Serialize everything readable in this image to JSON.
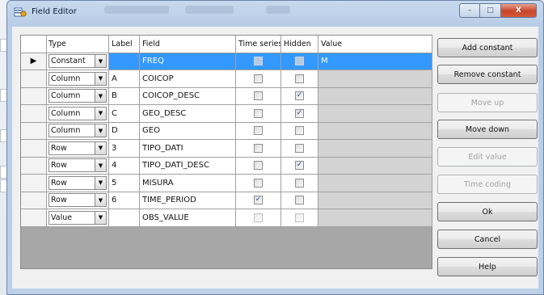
{
  "window": {
    "title": "Field Editor",
    "min_glyph": "–",
    "max_glyph": "□",
    "close_glyph": "X"
  },
  "grid": {
    "headers": [
      "Type",
      "Label",
      "Field",
      "Time series",
      "Hidden",
      "Value"
    ],
    "rows": [
      {
        "type": "Constant",
        "label": "",
        "field": "FREQ",
        "time_series": false,
        "hidden": false,
        "value": "M",
        "selected": true,
        "indicator": "▶"
      },
      {
        "type": "Column",
        "label": "A",
        "field": "COICOP",
        "time_series": false,
        "hidden": false,
        "value": ""
      },
      {
        "type": "Column",
        "label": "B",
        "field": "COICOP_DESC",
        "time_series": false,
        "hidden": true,
        "value": ""
      },
      {
        "type": "Column",
        "label": "C",
        "field": "GEO_DESC",
        "time_series": false,
        "hidden": true,
        "value": ""
      },
      {
        "type": "Column",
        "label": "D",
        "field": "GEO",
        "time_series": false,
        "hidden": false,
        "value": ""
      },
      {
        "type": "Row",
        "label": "3",
        "field": "TIPO_DATI",
        "time_series": false,
        "hidden": false,
        "value": ""
      },
      {
        "type": "Row",
        "label": "4",
        "field": "TIPO_DATI_DESC",
        "time_series": false,
        "hidden": true,
        "value": ""
      },
      {
        "type": "Row",
        "label": "5",
        "field": "MISURA",
        "time_series": false,
        "hidden": false,
        "value": ""
      },
      {
        "type": "Row",
        "label": "6",
        "field": "TIME_PERIOD",
        "time_series": true,
        "hidden": false,
        "value": ""
      },
      {
        "type": "Value",
        "label": "",
        "field": "OBS_VALUE",
        "time_series": false,
        "hidden": false,
        "value": "",
        "dim_checks": true
      }
    ]
  },
  "buttons": [
    {
      "id": "add-constant",
      "label": "Add constant",
      "enabled": true
    },
    {
      "id": "remove-constant",
      "label": "Remove constant",
      "enabled": true
    },
    {
      "id": "move-up",
      "label": "Move up",
      "enabled": false
    },
    {
      "id": "move-down",
      "label": "Move down",
      "enabled": true
    },
    {
      "id": "edit-value",
      "label": "Edit value",
      "enabled": false
    },
    {
      "id": "time-coding",
      "label": "Time coding",
      "enabled": false
    },
    {
      "id": "ok",
      "label": "Ok",
      "enabled": true
    },
    {
      "id": "cancel",
      "label": "Cancel",
      "enabled": true
    },
    {
      "id": "help",
      "label": "Help",
      "enabled": true
    }
  ],
  "icons": {
    "combo_arrow": "▼",
    "app_icon": "field-editor-app-icon"
  },
  "colors": {
    "selection": "#3399ff",
    "grid_empty": "#a7a7a7",
    "value_cell": "#d3d3d3",
    "close_button": "#c6452a"
  }
}
